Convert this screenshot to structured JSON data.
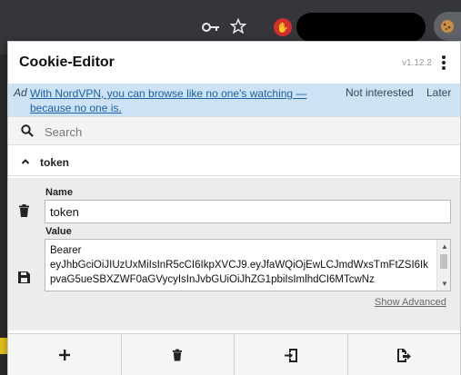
{
  "browser": {
    "key_icon": "key-icon",
    "star_icon": "star-icon",
    "extension_icon": "red-hand-extension-icon",
    "cookie_icon": "cookie-icon"
  },
  "popup": {
    "title": "Cookie-Editor",
    "version": "v1.12.2",
    "menu_icon": "kebab-menu-icon"
  },
  "ad": {
    "tag": "Ad",
    "text": "With NordVPN, you can browse like no one's watching — because no one is.",
    "not_interested": "Not interested",
    "later": "Later"
  },
  "search": {
    "placeholder": "Search",
    "value": ""
  },
  "cookie": {
    "name_header": "token",
    "name_label": "Name",
    "name_value": "token",
    "value_label": "Value",
    "value_value": "Bearer\neyJhbGciOiJIUzUxMiIsInR5cCI6IkpXVCJ9.eyJfaWQiOjEwLCJmdWxsTmFtZSI6IkpvaG5ueSBXZWF0aGVycyIsInJvbGUiOiJhZG1pbiIsImlhdCI6MTcwNz",
    "show_advanced": "Show Advanced"
  },
  "colors": {
    "ad_bg": "#cde3f5",
    "ad_link": "#1a5fa8",
    "editor_bg": "#ececec"
  }
}
